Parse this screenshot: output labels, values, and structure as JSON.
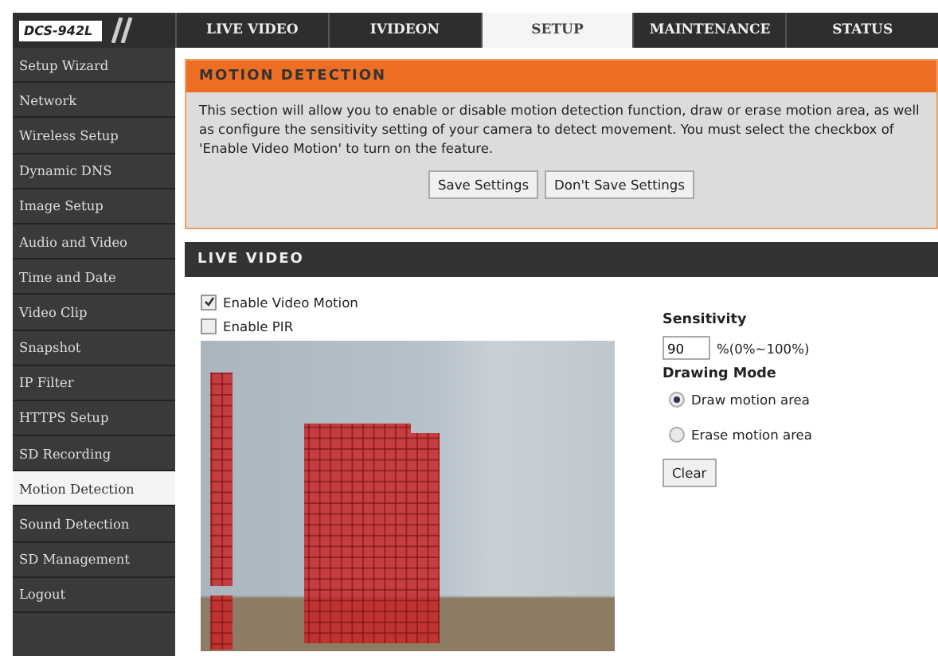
{
  "logo": "DCS-942L",
  "tabs": [
    {
      "label": "LIVE VIDEO",
      "selected": false
    },
    {
      "label": "IVIDEON",
      "selected": false
    },
    {
      "label": "SETUP",
      "selected": true
    },
    {
      "label": "MAINTENANCE",
      "selected": false
    },
    {
      "label": "STATUS",
      "selected": false
    }
  ],
  "sidebar": {
    "items": [
      {
        "label": "Setup Wizard",
        "selected": false
      },
      {
        "label": "Network",
        "selected": false
      },
      {
        "label": "Wireless Setup",
        "selected": false
      },
      {
        "label": "Dynamic DNS",
        "selected": false
      },
      {
        "label": "Image Setup",
        "selected": false
      },
      {
        "label": "Audio and Video",
        "selected": false
      },
      {
        "label": "Time and Date",
        "selected": false
      },
      {
        "label": "Video Clip",
        "selected": false
      },
      {
        "label": "Snapshot",
        "selected": false
      },
      {
        "label": "IP Filter",
        "selected": false
      },
      {
        "label": "HTTPS Setup",
        "selected": false
      },
      {
        "label": "SD Recording",
        "selected": false
      },
      {
        "label": "Motion Detection",
        "selected": true
      },
      {
        "label": "Sound Detection",
        "selected": false
      },
      {
        "label": "SD Management",
        "selected": false
      },
      {
        "label": "Logout",
        "selected": false
      }
    ]
  },
  "motion_detection": {
    "title": "MOTION DETECTION",
    "description": "This section will allow you to enable or disable motion detection function, draw or erase motion area, as well as configure the sensitivity setting of your camera to detect movement. You must select the checkbox of 'Enable Video Motion' to turn on the feature.",
    "buttons": [
      "Save Settings",
      "Don't Save Settings"
    ]
  },
  "live_video": {
    "title": "LIVE VIDEO",
    "checkboxes": [
      {
        "label": "Enable Video Motion",
        "checked": true
      },
      {
        "label": "Enable PIR",
        "checked": false
      }
    ],
    "sensitivity": {
      "label": "Sensitivity",
      "value": "90",
      "range": "%(0%~100%)"
    },
    "drawing_mode": {
      "label": "Drawing Mode",
      "options": [
        {
          "label": "Draw motion area",
          "selected": true
        },
        {
          "label": "Erase motion area",
          "selected": false
        }
      ]
    },
    "clear_button": "Clear"
  }
}
